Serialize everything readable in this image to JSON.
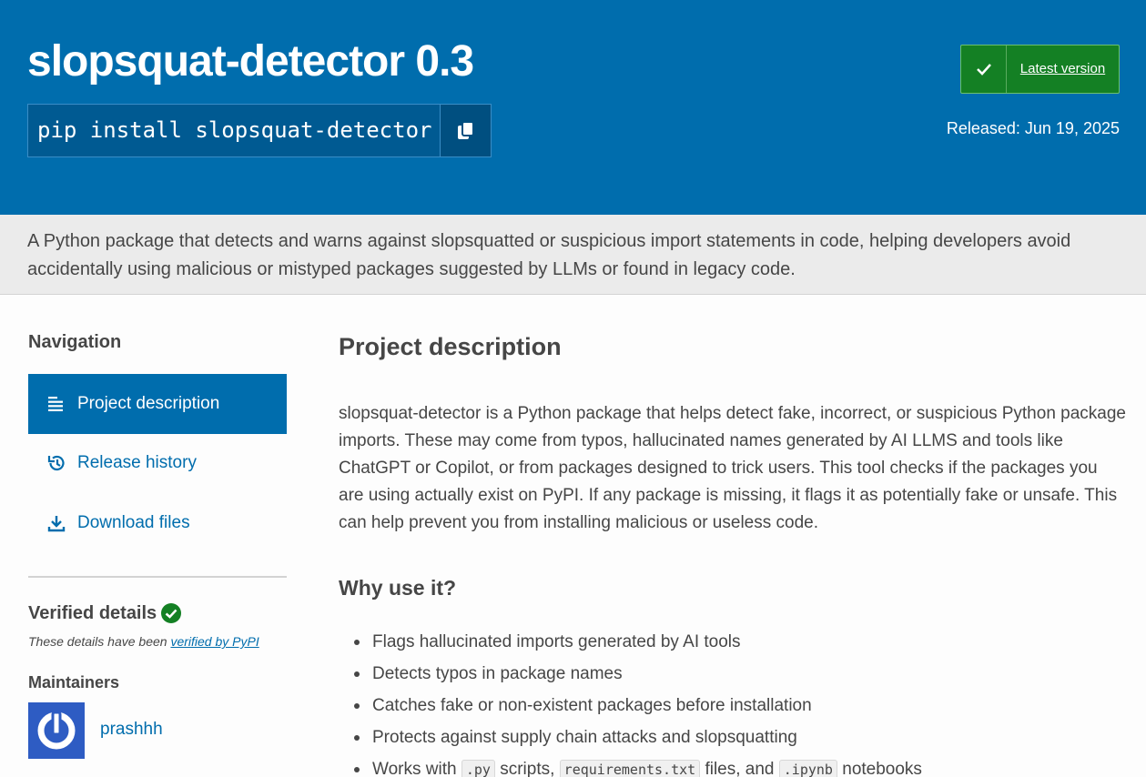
{
  "header": {
    "package_title": "slopsquat-detector 0.3",
    "pip_command": "pip install slopsquat-detector",
    "latest_version_label": "Latest version",
    "released": "Released: Jun 19, 2025"
  },
  "summary": "A Python package that detects and warns against slopsquatted or suspicious import statements in code, helping developers avoid accidentally using malicious or mistyped packages suggested by LLMs or found in legacy code.",
  "sidebar": {
    "navigation_heading": "Navigation",
    "items": [
      {
        "label": "Project description",
        "icon": "list-icon",
        "active": true
      },
      {
        "label": "Release history",
        "icon": "history-icon",
        "active": false
      },
      {
        "label": "Download files",
        "icon": "download-icon",
        "active": false
      }
    ],
    "verified_heading": "Verified details",
    "verified_note_prefix": "These details have been ",
    "verified_note_link": "verified by PyPI",
    "maintainers_heading": "Maintainers",
    "maintainer_name": "prashhh"
  },
  "main": {
    "heading": "Project description",
    "description": "slopsquat-detector is a Python package that helps detect fake, incorrect, or suspicious Python package imports. These may come from typos, hallucinated names generated by AI LLMS and tools like ChatGPT or Copilot, or from packages designed to trick users. This tool checks if the packages you are using actually exist on PyPI. If any package is missing, it flags it as potentially fake or unsafe. This can help prevent you from installing malicious or useless code.",
    "why_heading": "Why use it?",
    "bullets": [
      "Flags hallucinated imports generated by AI tools",
      "Detects typos in package names",
      "Catches fake or non-existent packages before installation",
      "Protects against supply chain attacks and slopsquatting"
    ],
    "last_bullet": {
      "prefix": "Works with ",
      "code1": ".py",
      "text1": " scripts, ",
      "code2": "requirements.txt",
      "text2": " files, and ",
      "code3": ".ipynb",
      "text3": " notebooks"
    }
  },
  "colors": {
    "brand_blue": "#006dad",
    "success_green": "#148024",
    "summary_background": "#ebebeb",
    "avatar_blue": "#2e5cc3"
  }
}
